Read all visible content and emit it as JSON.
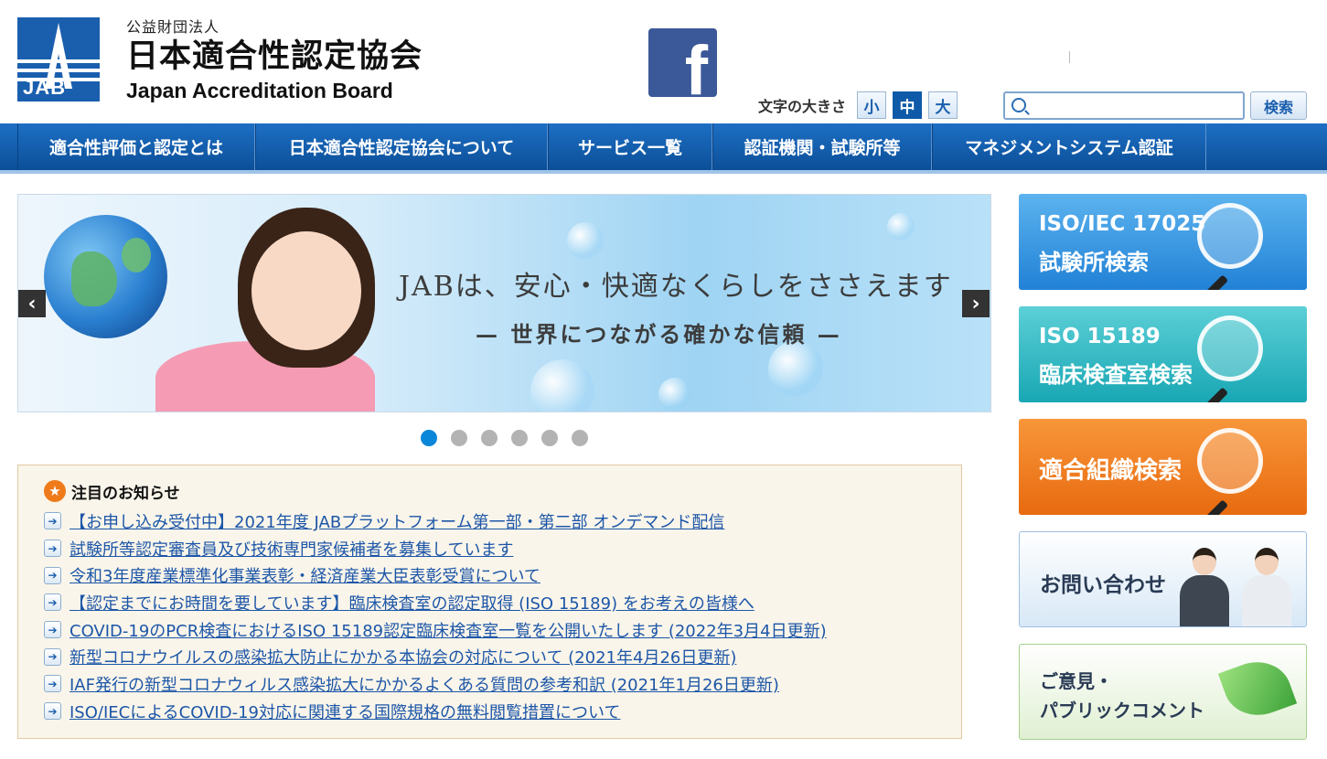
{
  "header": {
    "org_type": "公益財団法人",
    "org_name_ja": "日本適合性認定協会",
    "org_name_en": "Japan Accreditation Board",
    "logo_text": "JAB",
    "facebook_icon_text": "f",
    "font_size_label": "文字の大きさ",
    "font_sizes": [
      "小",
      "中",
      "大"
    ],
    "font_size_selected": "中",
    "search_placeholder": "",
    "search_button": "検索"
  },
  "nav": {
    "items": [
      "適合性評価と認定とは",
      "日本適合性認定協会について",
      "サービス一覧",
      "認証機関・試験所等",
      "マネジメントシステム認証"
    ]
  },
  "hero": {
    "title": "JABは、安心・快適なくらしをささえます",
    "subtitle": "— 世界につながる確かな信頼 —",
    "prev_icon": "‹",
    "next_icon": "›",
    "slide_count": 6,
    "active_slide": 1
  },
  "news": {
    "title": "注目のお知らせ",
    "items": [
      "【お申し込み受付中】2021年度 JABプラットフォーム第一部・第二部 オンデマンド配信",
      "試験所等認定審査員及び技術専門家候補者を募集しています",
      "令和3年度産業標準化事業表彰・経済産業大臣表彰受賞について",
      "【認定までにお時間を要しています】臨床検査室の認定取得 (ISO 15189) をお考えの皆様へ",
      "COVID-19のPCR検査におけるISO 15189認定臨床検査室一覧を公開いたします (2022年3月4日更新)",
      "新型コロナウイルスの感染拡大防止にかかる本協会の対応について (2021年4月26日更新)",
      "IAF発行の新型コロナウィルス感染拡大にかかるよくある質問の参考和訳 (2021年1月26日更新)",
      "ISO/IECによるCOVID-19対応に関連する国際規格の無料閲覧措置について"
    ]
  },
  "side": {
    "lab_search": {
      "line1": "ISO/IEC 17025",
      "line2": "試験所検索"
    },
    "clinical_search": {
      "line1": "ISO 15189",
      "line2": "臨床検査室検索"
    },
    "org_search": {
      "line1": "適合組織検索"
    },
    "contact": {
      "line1": "お問い合わせ"
    },
    "opinion": {
      "line1": "ご意見・",
      "line2": "パブリックコメント"
    }
  },
  "colors": {
    "brand_blue": "#1a5fae",
    "nav_blue": "#0c4f98",
    "orange": "#e86a0f",
    "teal": "#18a7b4",
    "link": "#1c56a8"
  }
}
